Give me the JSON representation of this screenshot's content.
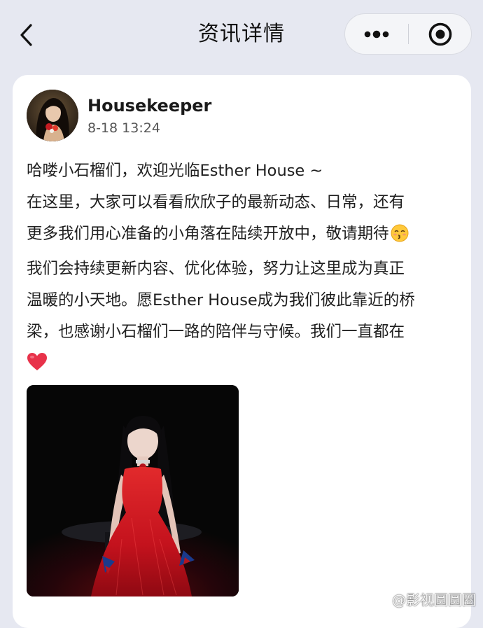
{
  "nav": {
    "title": "资讯详情",
    "back_icon": "chevron-left-icon",
    "more_icon": "more-dots-icon",
    "close_icon": "target-close-icon"
  },
  "post": {
    "author": {
      "name": "Housekeeper",
      "avatar_icon": "avatar"
    },
    "time": "8-18 13:24",
    "content_lines": [
      "哈喽小石榴们，欢迎光临Esther House ~",
      "在这里，大家可以看看欣欣子的最新动态、日常，还有",
      "更多我们用心准备的小角落在陆续开放中，敬请期待",
      "我们会持续更新内容、优化体验，努力让这里成为真正",
      "温暖的小天地。愿Esther House成为我们彼此靠近的桥",
      "梁，也感谢小石榴们一路的陪伴与守候。我们一直都在"
    ],
    "emojis": [
      "kissing-face-icon",
      "red-heart-icon"
    ],
    "image": "photo-woman-red-dress"
  },
  "watermark": {
    "text": "@影视圆圆圈",
    "icon": "weibo-icon"
  },
  "colors": {
    "page_bg": "#e6e8f1",
    "card_bg": "#ffffff",
    "heart": "#e8324a",
    "dress": "#c4121d"
  }
}
